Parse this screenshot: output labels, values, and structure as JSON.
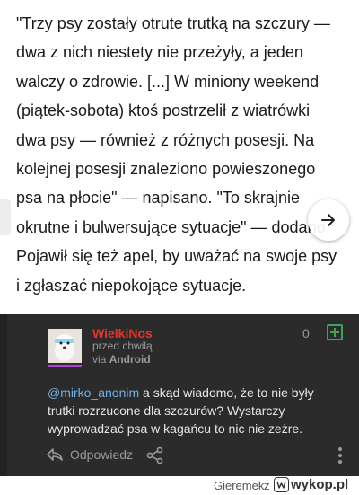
{
  "article": {
    "text": "\"Trzy psy zostały otrute trutką na szczury — dwa z nich niestety nie przeżyły, a jeden walczy o zdrowie. [...] W miniony weekend (piątek-sobota) ktoś postrzelił z wiatrówki dwa psy — również z różnych posesji. Na kolejnej posesji znaleziono powieszonego psa na płocie\" — napisano. \"To skrajnie okrutne i bulwersujące sytuacje\" — dodano. Pojawił się też apel, by uważać na swoje psy i zgłaszać niepokojące sytuacje."
  },
  "comment": {
    "username": "WielkiNos",
    "time": "przed chwilą",
    "via_prefix": "via",
    "via_app": "Android",
    "votes": "0",
    "mention": "@mirko_anonim",
    "body": " a skąd wiadomo, że to nie były trutki rozrzucone dla szczurów? Wystarczy wyprowadzać psa w kagańcu to nic nie zeżre.",
    "reply_label": "Odpowiedz",
    "accent_color": "#e8332a",
    "plus_color": "#3aa655"
  },
  "footer": {
    "user": "Gieremek",
    "sep": "z",
    "logo_text": "wykop.pl"
  }
}
